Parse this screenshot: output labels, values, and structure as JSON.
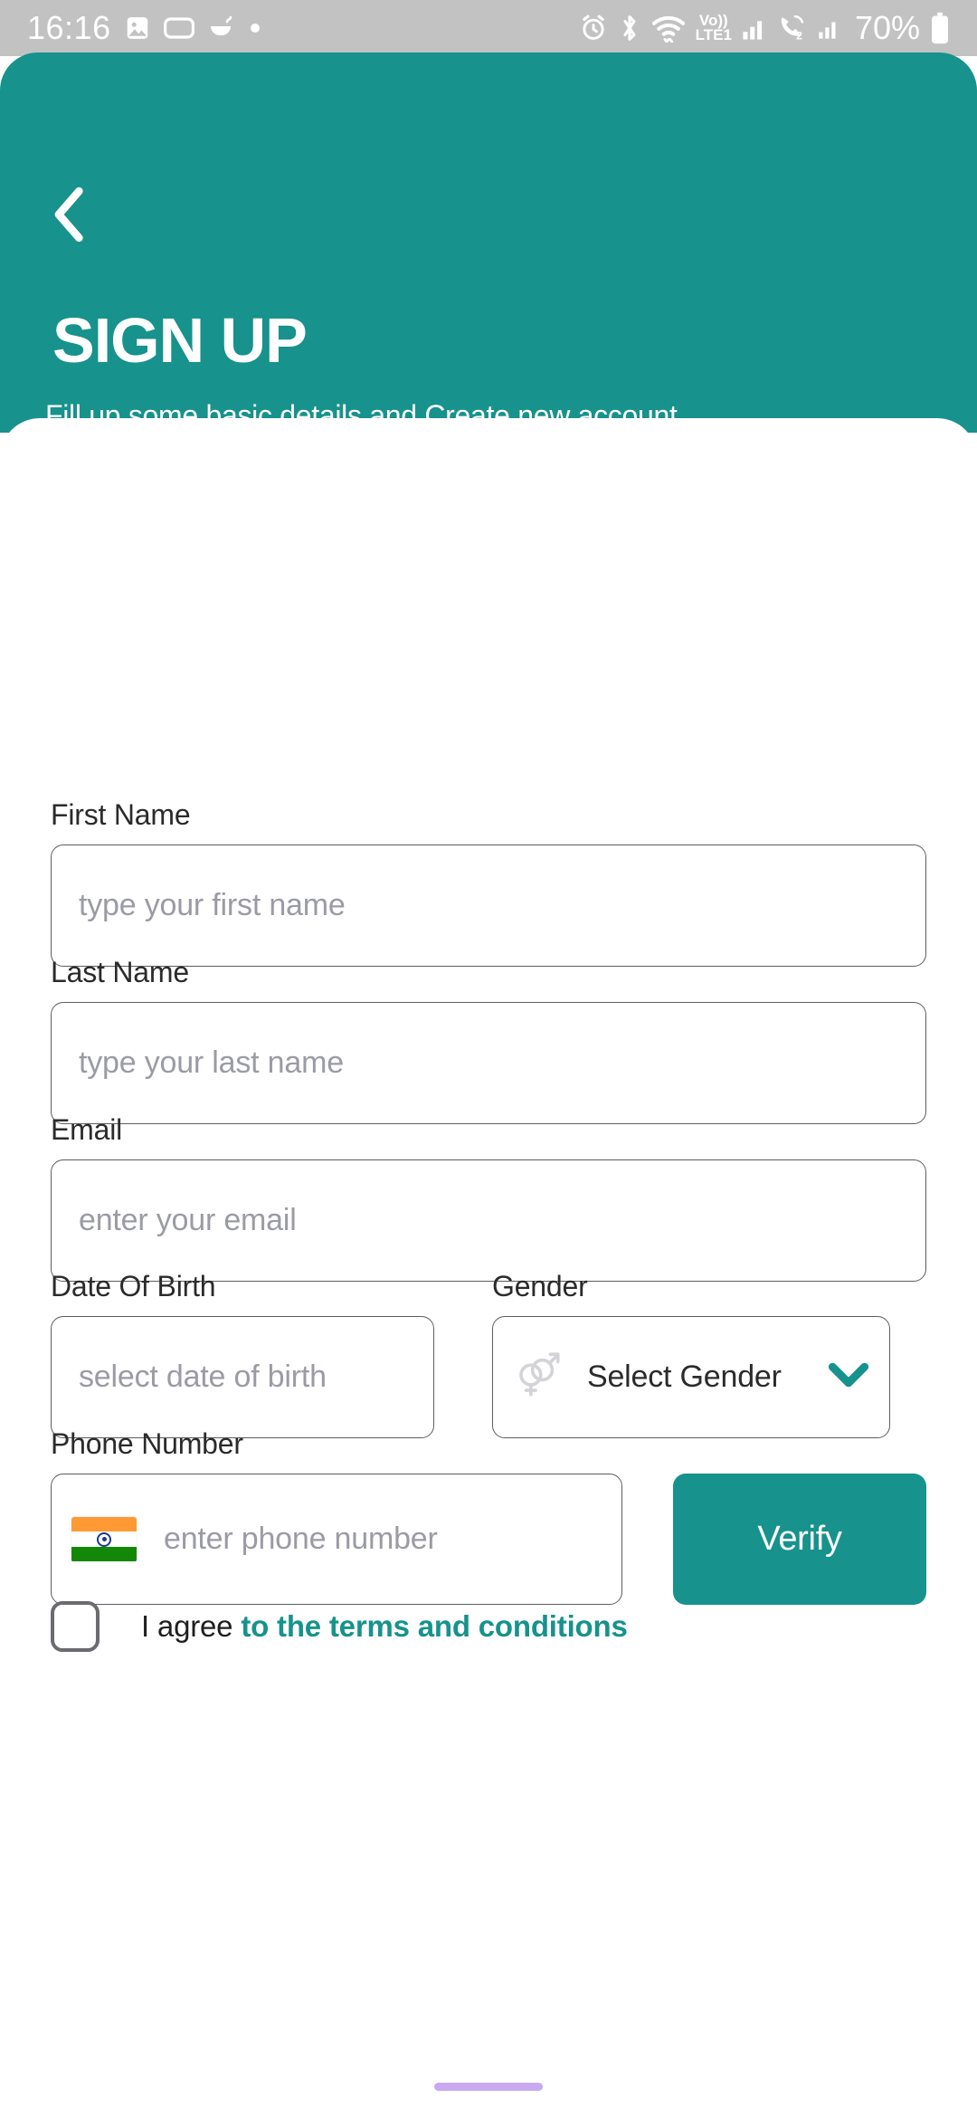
{
  "status_bar": {
    "time": "16:16",
    "battery_percent": "70%",
    "left_icons": [
      "photo-icon",
      "screen-record-icon",
      "app-icon",
      "dot-icon"
    ],
    "right_icons": [
      "alarm-icon",
      "bluetooth-icon",
      "wifi-icon",
      "volte-icon",
      "signal-1-icon",
      "call-sim2-icon",
      "signal-2-icon"
    ],
    "volte_label": "Vo))",
    "lte_label": "LTE1",
    "sim2_label": "2"
  },
  "header": {
    "back_icon": "chevron-left-icon",
    "title": "SIGN UP",
    "subtitle": "Fill up some basic details and Create new account",
    "background_color": "#17928c"
  },
  "form": {
    "first_name": {
      "label": "First Name",
      "placeholder": "type your first name",
      "value": ""
    },
    "last_name": {
      "label": "Last Name",
      "placeholder": "type your last name",
      "value": ""
    },
    "email": {
      "label": "Email",
      "placeholder": "enter your email",
      "value": ""
    },
    "dob": {
      "label": "Date Of Birth",
      "placeholder": "select date of birth",
      "value": ""
    },
    "gender": {
      "label": "Gender",
      "selected": "Select Gender",
      "icon": "gender-symbols-icon",
      "chevron": "chevron-down-icon",
      "chevron_color": "#17928c"
    },
    "phone": {
      "label": "Phone Number",
      "placeholder": "enter phone number",
      "value": "",
      "country_flag": "india-flag-icon",
      "verify_label": "Verify"
    },
    "terms": {
      "checked": false,
      "text_plain": "I agree ",
      "text_link": "to the terms and conditions",
      "link_color": "#17928c"
    }
  },
  "system_nav": {
    "home_indicator_color": "#c9aaf0"
  }
}
